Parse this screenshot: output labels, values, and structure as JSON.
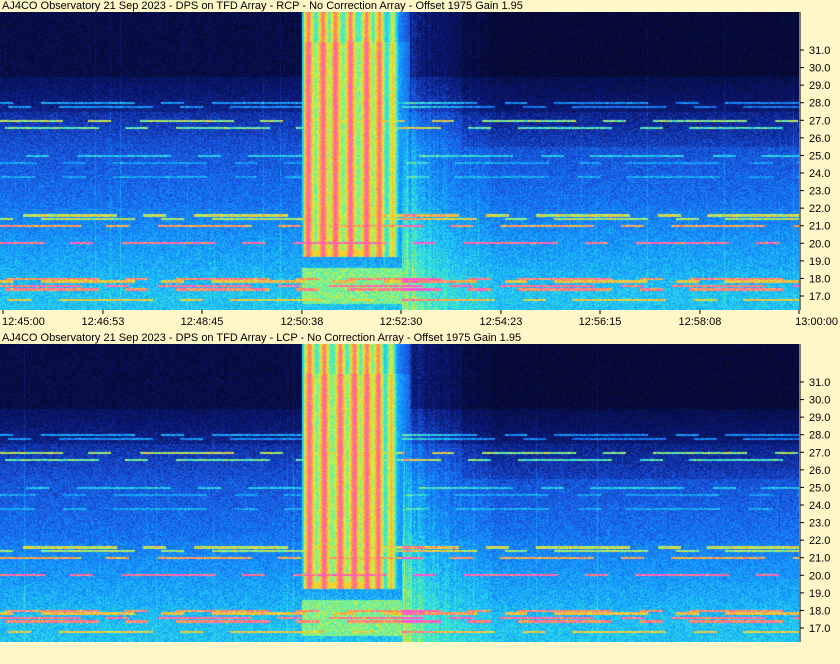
{
  "chart_data": [
    {
      "type": "heatmap",
      "title": "AJ4CO Observatory 21 Sep 2023 - DPS on TFD Array  - RCP  -  No Correction Array  -  Offset 1975  Gain 1.95",
      "ylim": [
        16.5,
        32.0
      ],
      "y_ticks": [
        "31.0",
        "30.0",
        "29.0",
        "28.0",
        "27.0",
        "26.0",
        "25.0",
        "24.0",
        "23.0",
        "22.0",
        "21.0",
        "20.0",
        "19.0",
        "18.0",
        "17.0"
      ],
      "x_ticks": [
        "12:45:00",
        "12:46:53",
        "12:48:45",
        "12:50:38",
        "12:52:30",
        "12:54:23",
        "12:56:15",
        "12:58:08",
        "13:00:00"
      ],
      "burst": {
        "start": "12:50:38",
        "end": "12:52:30",
        "low_edge": 19.5
      }
    },
    {
      "type": "heatmap",
      "title": "AJ4CO Observatory 21 Sep 2023 - DPS on TFD Array  - LCP  -  No Correction Array  -  Offset 1975  Gain 1.95",
      "ylim": [
        16.5,
        32.0
      ],
      "y_ticks": [
        "31.0",
        "30.0",
        "29.0",
        "28.0",
        "27.0",
        "26.0",
        "25.0",
        "24.0",
        "23.0",
        "22.0",
        "21.0",
        "20.0",
        "19.0",
        "18.0",
        "17.0"
      ],
      "burst": {
        "start": "12:50:38",
        "end": "12:52:30",
        "low_edge": 19.5
      }
    }
  ],
  "colors": {
    "background": "#fff7c8",
    "low": "#060a3a",
    "mid": "#1a5fff",
    "high": "#ff6fd0"
  }
}
